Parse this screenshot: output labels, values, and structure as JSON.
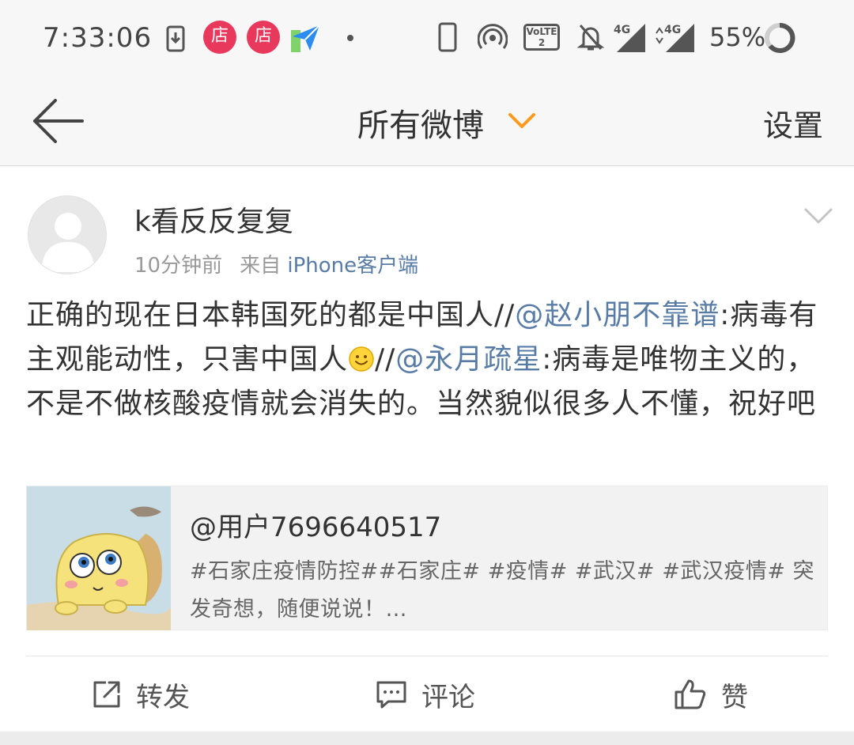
{
  "status_bar": {
    "time": "7:33:06",
    "battery_percent": "55%",
    "notification_badge_text": "店",
    "network_labels": [
      "4G",
      "4G"
    ],
    "volte_label": "VoLTE 2",
    "icons": [
      "download-icon",
      "store-notification-icon",
      "store-notification-icon",
      "send-icon",
      "dot-icon",
      "phone-icon",
      "hotspot-icon",
      "volte-icon",
      "mute-icon",
      "signal-icon",
      "signal-icon",
      "battery-icon"
    ]
  },
  "nav": {
    "title": "所有微博",
    "settings_label": "设置",
    "back_icon": "back-arrow-icon",
    "dropdown_icon": "chevron-down-icon",
    "accent_color": "#ff9a1f"
  },
  "post": {
    "username": "k看反反复复",
    "time_ago": "10分钟前",
    "source_prefix": "来自",
    "source": "iPhone客户端",
    "text_1": "正确的现在日本韩国死的都是中国人//",
    "mention_1": "@赵小朋不靠谱",
    "text_2": ":病毒有主观能动性，只害中国人",
    "emoji": "smile-emoji",
    "text_3": "//",
    "mention_2": "@永月疏星",
    "text_4": ":病毒是唯物主义的，不是不做核酸疫情就会消失的。当然貌似很多人不懂，祝好吧",
    "link_color": "#587ca6"
  },
  "repost": {
    "user": "@用户7696640517",
    "text": "#石家庄疫情防控##石家庄# #疫情# #武汉# #武汉疫情# 突发奇想，随便说说！…"
  },
  "actions": {
    "repost_label": "转发",
    "comment_label": "评论",
    "like_label": "赞"
  }
}
